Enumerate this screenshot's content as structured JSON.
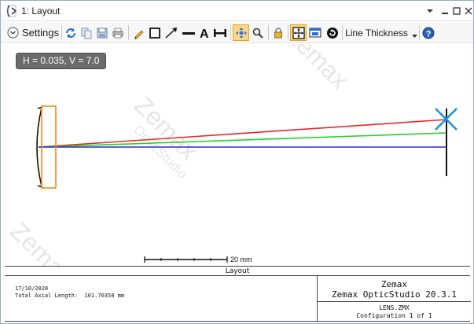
{
  "window": {
    "title": "1: Layout",
    "icon": "zemax-window-icon",
    "controls": [
      "chevron-down-icon",
      "minimize-icon",
      "maximize-icon",
      "close-icon"
    ]
  },
  "toolbar": {
    "settings_label": "Settings",
    "line_thickness_label": "Line Thickness",
    "icons": [
      "refresh-icon",
      "copy-icon",
      "save-icon",
      "print-icon",
      "pencil-icon",
      "rectangle-icon",
      "arrow-icon",
      "line-icon",
      "text-icon",
      "dimension-icon",
      "pan-icon",
      "zoom-icon",
      "lock-icon",
      "fit-icon",
      "window-icon",
      "reset-icon",
      "help-icon"
    ]
  },
  "plot": {
    "info_badge": "H = 0.035, V = 7.0",
    "scale_bar_label": "20 mm",
    "watermark": "Zemax OpticStudio",
    "colors": {
      "ray_red": "#e8262a",
      "ray_green": "#22d12a",
      "ray_blue": "#2a2ad8",
      "lens": "#f08a1c",
      "marker": "#1f8fe0"
    }
  },
  "footer": {
    "title": "Layout",
    "date": "17/10/2020",
    "axial_length": "Total Axial Length:  101.70358 mm",
    "company": "Zemax",
    "product": "Zemax OpticStudio 20.3.1",
    "file": "LENS.ZMX",
    "configuration": "Configuration 1 of 1"
  }
}
